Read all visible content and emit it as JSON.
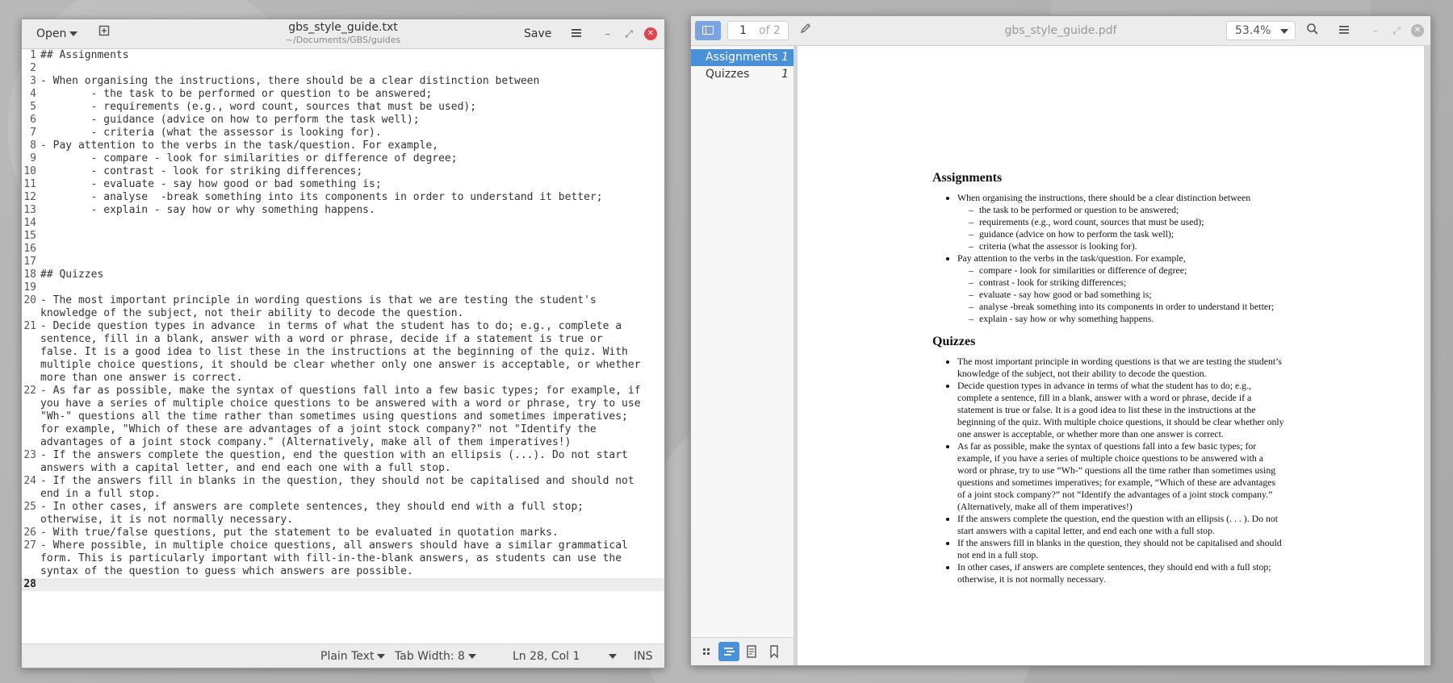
{
  "editor": {
    "header": {
      "open_label": "Open",
      "save_label": "Save",
      "filename": "gbs_style_guide.txt",
      "path": "~/Documents/GBS/guides"
    },
    "lines": [
      {
        "n": "1",
        "t": "## Assignments"
      },
      {
        "n": "2",
        "t": ""
      },
      {
        "n": "3",
        "t": "- When organising the instructions, there should be a clear distinction between"
      },
      {
        "n": "4",
        "t": "        - the task to be performed or question to be answered;"
      },
      {
        "n": "5",
        "t": "        - requirements (e.g., word count, sources that must be used);"
      },
      {
        "n": "6",
        "t": "        - guidance (advice on how to perform the task well);"
      },
      {
        "n": "7",
        "t": "        - criteria (what the assessor is looking for)."
      },
      {
        "n": "8",
        "t": "- Pay attention to the verbs in the task/question. For example,"
      },
      {
        "n": "9",
        "t": "        - compare - look for similarities or difference of degree;"
      },
      {
        "n": "10",
        "t": "        - contrast - look for striking differences;"
      },
      {
        "n": "11",
        "t": "        - evaluate - say how good or bad something is;"
      },
      {
        "n": "12",
        "t": "        - analyse  -break something into its components in order to understand it better;"
      },
      {
        "n": "13",
        "t": "        - explain - say how or why something happens."
      },
      {
        "n": "14",
        "t": ""
      },
      {
        "n": "15",
        "t": ""
      },
      {
        "n": "16",
        "t": ""
      },
      {
        "n": "17",
        "t": ""
      },
      {
        "n": "18",
        "t": "## Quizzes"
      },
      {
        "n": "19",
        "t": ""
      },
      {
        "n": "20",
        "t": "- The most important principle in wording questions is that we are testing the student's knowledge of the subject, not their ability to decode the question."
      },
      {
        "n": "21",
        "t": "- Decide question types in advance  in terms of what the student has to do; e.g., complete a sentence, fill in a blank, answer with a word or phrase, decide if a statement is true or false. It is a good idea to list these in the instructions at the beginning of the quiz. With multiple choice questions, it should be clear whether only one answer is acceptable, or whether more than one answer is correct."
      },
      {
        "n": "22",
        "t": "- As far as possible, make the syntax of questions fall into a few basic types; for example, if you have a series of multiple choice questions to be answered with a word or phrase, try to use \"Wh-\" questions all the time rather than sometimes using questions and sometimes imperatives; for example, \"Which of these are advantages of a joint stock company?\" not \"Identify the advantages of a joint stock company.\" (Alternatively, make all of them imperatives!)"
      },
      {
        "n": "23",
        "t": "- If the answers complete the question, end the question with an ellipsis (...). Do not start answers with a capital letter, and end each one with a full stop."
      },
      {
        "n": "24",
        "t": "- If the answers fill in blanks in the question, they should not be capitalised and should not end in a full stop."
      },
      {
        "n": "25",
        "t": "- In other cases, if answers are complete sentences, they should end with a full stop; otherwise, it is not normally necessary."
      },
      {
        "n": "26",
        "t": "- With true/false questions, put the statement to be evaluated in quotation marks."
      },
      {
        "n": "27",
        "t": "- Where possible, in multiple choice questions, all answers should have a similar grammatical form. This is particularly important with fill-in-the-blank answers, as students can use the syntax of the question to guess which answers are possible."
      },
      {
        "n": "28",
        "t": ""
      }
    ],
    "current_line": "28",
    "status": {
      "language": "Plain Text",
      "tab_width": "Tab Width: 8",
      "position": "Ln 28, Col 1",
      "mode": "INS"
    }
  },
  "viewer": {
    "page_current": "1",
    "page_of": "of 2",
    "title": "gbs_style_guide.pdf",
    "zoom": "53.4%",
    "outline": [
      {
        "label": "Assignments",
        "page": "1"
      },
      {
        "label": "Quizzes",
        "page": "1"
      }
    ],
    "doc": {
      "h1": "Assignments",
      "a1": "When organising the instructions, there should be a clear distinction between",
      "a1_sub": [
        "the task to be performed or question to be answered;",
        "requirements (e.g., word count, sources that must be used);",
        "guidance (advice on how to perform the task well);",
        "criteria (what the assessor is looking for)."
      ],
      "a2": "Pay attention to the verbs in the task/question. For example,",
      "a2_sub": [
        "compare - look for similarities or difference of degree;",
        "contrast - look for striking differences;",
        "evaluate - say how good or bad something is;",
        "analyse -break something into its components in order to understand it better;",
        "explain - say how or why something happens."
      ],
      "h2": "Quizzes",
      "quiz": [
        "The most important principle in wording questions is that we are testing the student’s knowledge of the subject, not their ability to decode the question.",
        "Decide question types in advance in terms of what the student has to do; e.g., complete a sentence, fill in a blank, answer with a word or phrase, decide if a statement is true or false. It is a good idea to list these in the instructions at the beginning of the quiz. With multiple choice questions, it should be clear whether only one answer is acceptable, or whether more than one answer is correct.",
        "As far as possible, make the syntax of questions fall into a few basic types; for example, if you have a series of multiple choice questions to be answered with a word or phrase, try to use “Wh-” questions all the time rather than sometimes using questions and sometimes imperatives; for example, “Which of these are advantages of a joint stock company?” not “Identify the advantages of a joint stock company.” (Alternatively, make all of them imperatives!)",
        "If the answers complete the question, end the question with an ellipsis (. . . ). Do not start answers with a capital letter, and end each one with a full stop.",
        "If the answers fill in blanks in the question, they should not be capitalised and should not end in a full stop.",
        "In other cases, if answers are complete sentences, they should end with a full stop; otherwise, it is not normally necessary."
      ]
    }
  },
  "colors": {
    "accent": "#4a90d9",
    "close_red": "#e0454a"
  }
}
